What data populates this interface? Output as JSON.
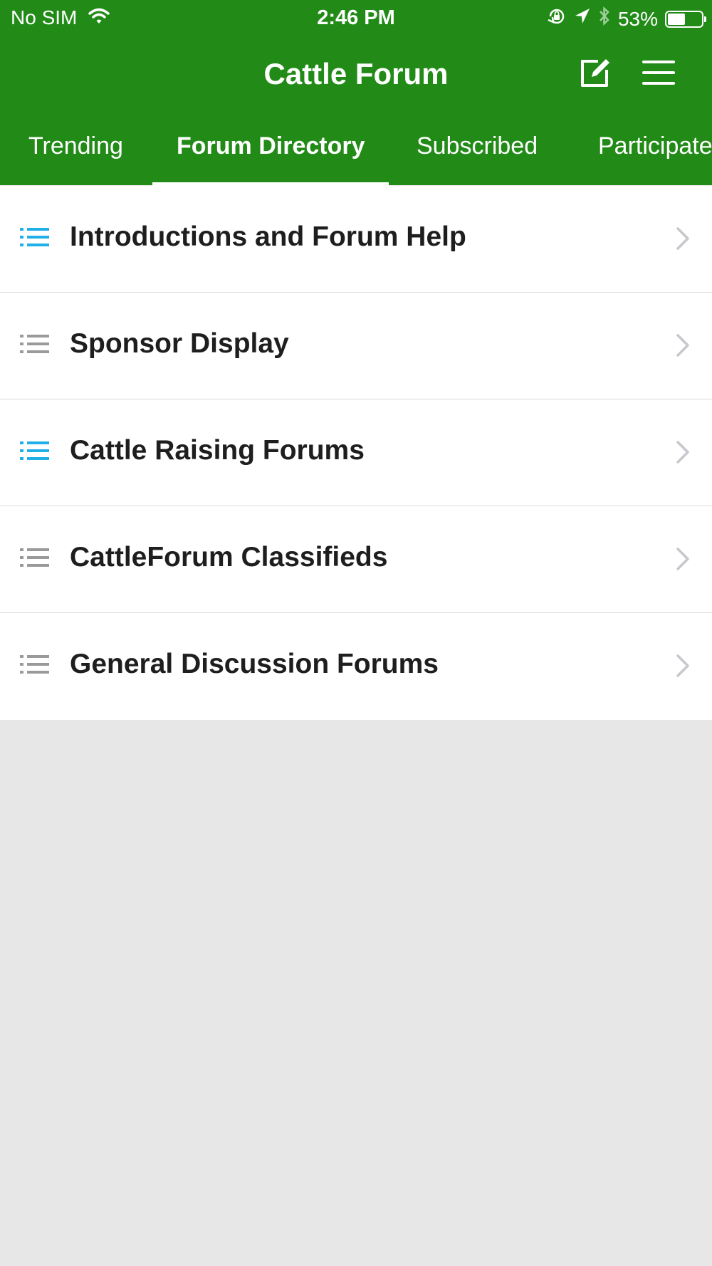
{
  "status": {
    "carrier": "No SIM",
    "time": "2:46 PM",
    "battery_text": "53%",
    "battery_level": 0.53,
    "icons": [
      "wifi-icon",
      "rotation-lock-icon",
      "location-arrow-icon",
      "bluetooth-icon",
      "battery-icon"
    ]
  },
  "header": {
    "title": "Cattle Forum",
    "icons": [
      "compose-icon",
      "hamburger-menu-icon"
    ]
  },
  "tabs": [
    {
      "label": "Trending",
      "active": false
    },
    {
      "label": "Forum Directory",
      "active": true
    },
    {
      "label": "Subscribed",
      "active": false
    },
    {
      "label": "Participated",
      "active": false
    }
  ],
  "forums": [
    {
      "label": "Introductions and Forum Help",
      "icon_color": "#1eb0e6"
    },
    {
      "label": "Sponsor Display",
      "icon_color": "#9a9a9a"
    },
    {
      "label": "Cattle Raising Forums",
      "icon_color": "#1eb0e6"
    },
    {
      "label": "CattleForum Classifieds",
      "icon_color": "#9a9a9a"
    },
    {
      "label": "General Discussion Forums",
      "icon_color": "#9a9a9a"
    }
  ],
  "colors": {
    "header_bg": "#228b18",
    "content_bg": "#e7e7e7",
    "accent_blue": "#1eb0e6",
    "icon_gray": "#9a9a9a"
  }
}
